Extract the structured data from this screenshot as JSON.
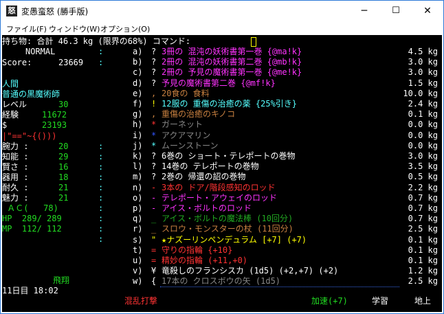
{
  "window": {
    "title": "変愚蛮怒 (勝手版)",
    "icon": "app-icon",
    "minimize": "─",
    "maximize": "☐",
    "close": "✕"
  },
  "menu": [
    "ファイル(F)",
    "ウィンドウ(W)",
    "オプション(O)"
  ],
  "header": "持ち物: 合計 46.3 kg (限界の68%) コマンド:",
  "status": {
    "difficulty": "NORMAL",
    "score_label": "Score:",
    "score": "23669",
    "race": "人間",
    "title": "普通の黒魔術師",
    "level_label": "レベル",
    "level": "30",
    "exp_label": "経験",
    "exp": "11672",
    "gold_label": "$",
    "gold": "23193",
    "equip_glyphs": "|\"==\"~{()))",
    "stats": [
      {
        "label": "腕力 :",
        "value": "20"
      },
      {
        "label": "知能 :",
        "value": "29"
      },
      {
        "label": "賢さ :",
        "value": "16"
      },
      {
        "label": "器用 :",
        "value": "18"
      },
      {
        "label": "耐久 :",
        "value": "21"
      },
      {
        "label": "魅力 :",
        "value": "21"
      }
    ],
    "ac": " ＡＣ(   78)",
    "hp": "HP  289/ 289",
    "mp": "MP  112/ 112",
    "levitation": "飛翔",
    "time": "11日目 18:02"
  },
  "colon": ":",
  "items": [
    {
      "letter": "a)",
      "sym": "?",
      "name": "3冊の 混沌の妖術書第一巻 {@ma!k}",
      "weight": "4.5 kg",
      "sym_color": "#ffffff",
      "color": "#ff33ff"
    },
    {
      "letter": "b)",
      "sym": "?",
      "name": "2冊の 混沌の妖術書第二巻 {@mb!k}",
      "weight": "3.0 kg",
      "sym_color": "#ffffff",
      "color": "#ff33ff"
    },
    {
      "letter": "c)",
      "sym": "?",
      "name": "2冊の 予見の魔術書第一巻 {@me!k}",
      "weight": "3.0 kg",
      "sym_color": "#ffffff",
      "color": "#ff33ff"
    },
    {
      "letter": "d)",
      "sym": "?",
      "name": "予見の魔術書第二巻 {@mf!k}",
      "weight": "1.5 kg",
      "sym_color": "#ffffff",
      "color": "#ff33ff"
    },
    {
      "letter": "e)",
      "sym": ",",
      "name": "20食の 食料",
      "weight": "10.0 kg",
      "sym_color": "#c88040",
      "color": "#c88040"
    },
    {
      "letter": "f)",
      "sym": "!",
      "name": "12服の 重傷の治癒の薬 {25%引き}",
      "weight": "2.4 kg",
      "sym_color": "#ffff00",
      "color": "#55ffff"
    },
    {
      "letter": "g)",
      "sym": ",",
      "name": "重傷の治癒のキノコ",
      "weight": "0.1 kg",
      "sym_color": "#c88040",
      "color": "#c88040"
    },
    {
      "letter": "h)",
      "sym": "*",
      "name": "ガーネット",
      "weight": "0.0 kg",
      "sym_color": "#ff3333",
      "color": "#888888"
    },
    {
      "letter": "i)",
      "sym": "*",
      "name": "アクアマリン",
      "weight": "0.0 kg",
      "sym_color": "#3355ff",
      "color": "#888888"
    },
    {
      "letter": "j)",
      "sym": "*",
      "name": "ムーンストーン",
      "weight": "0.0 kg",
      "sym_color": "#55ffff",
      "color": "#888888"
    },
    {
      "letter": "k)",
      "sym": "?",
      "name": "6巻の ショート・テレポートの巻物",
      "weight": "3.0 kg",
      "sym_color": "#ffffff",
      "color": "#ffffff"
    },
    {
      "letter": "l)",
      "sym": "?",
      "name": "14巻の テレポートの巻物",
      "weight": "3.5 kg",
      "sym_color": "#ffffff",
      "color": "#ffffff"
    },
    {
      "letter": "m)",
      "sym": "?",
      "name": "2巻の 帰還の詔の巻物",
      "weight": "0.5 kg",
      "sym_color": "#ffffff",
      "color": "#ffffff"
    },
    {
      "letter": "n)",
      "sym": "-",
      "name": "3本の ドア/階段感知のロッド",
      "weight": "2.2 kg",
      "sym_color": "#ff3333",
      "color": "#ff3333"
    },
    {
      "letter": "o)",
      "sym": "-",
      "name": "テレポート・アウェイのロッド",
      "weight": "0.7 kg",
      "sym_color": "#ff33ff",
      "color": "#ff33ff"
    },
    {
      "letter": "p)",
      "sym": "-",
      "name": "アイス・ボルトのロッド",
      "weight": "0.7 kg",
      "sym_color": "#ff33ff",
      "color": "#ff33ff"
    },
    {
      "letter": "q)",
      "sym": "_",
      "name": "アイス・ボルトの魔法棒 (10回分)",
      "weight": "0.7 kg",
      "sym_color": "#22aa22",
      "color": "#22aa22"
    },
    {
      "letter": "r)",
      "sym": "_",
      "name": "スロウ・モンスターの杖 (11回分)",
      "weight": "2.5 kg",
      "sym_color": "#c88040",
      "color": "#c88040"
    },
    {
      "letter": "s)",
      "sym": "\"",
      "name": "★ナズーリンペンデュラム [+7] (+7)",
      "weight": "0.1 kg",
      "sym_color": "#ffff00",
      "color": "#ffff00"
    },
    {
      "letter": "t)",
      "sym": "=",
      "name": "守りの指輪 {+10}",
      "weight": "0.1 kg",
      "sym_color": "#ff3333",
      "color": "#ff3333"
    },
    {
      "letter": "u)",
      "sym": "=",
      "name": "精妙の指輪 (+11,+0)",
      "weight": "0.1 kg",
      "sym_color": "#ff3333",
      "color": "#ff3333"
    },
    {
      "letter": "v)",
      "sym": "¥",
      "name": "竜殺しのフランシスカ (1d5) (+2,+7) (+2)",
      "weight": "1.2 kg",
      "sym_color": "#ffffff",
      "color": "#ffffff"
    },
    {
      "letter": "w)",
      "sym": "{",
      "name": "17本の クロスボウの矢 (1d5)",
      "weight": "2.5 kg",
      "sym_color": "#ffffff",
      "color": "#888888"
    }
  ],
  "bottom": {
    "confusing": "混乱打撃",
    "speed": "加速(+7)",
    "study": "学習",
    "ground": "地上"
  },
  "colors": {
    "term_bg": "#000000",
    "white": "#ffffff",
    "cyan": "#55ffff",
    "green": "#22dd22",
    "red": "#ff3333",
    "yellow": "#ffff00",
    "orange": "#c88040",
    "title_border": "#2b79d8"
  }
}
